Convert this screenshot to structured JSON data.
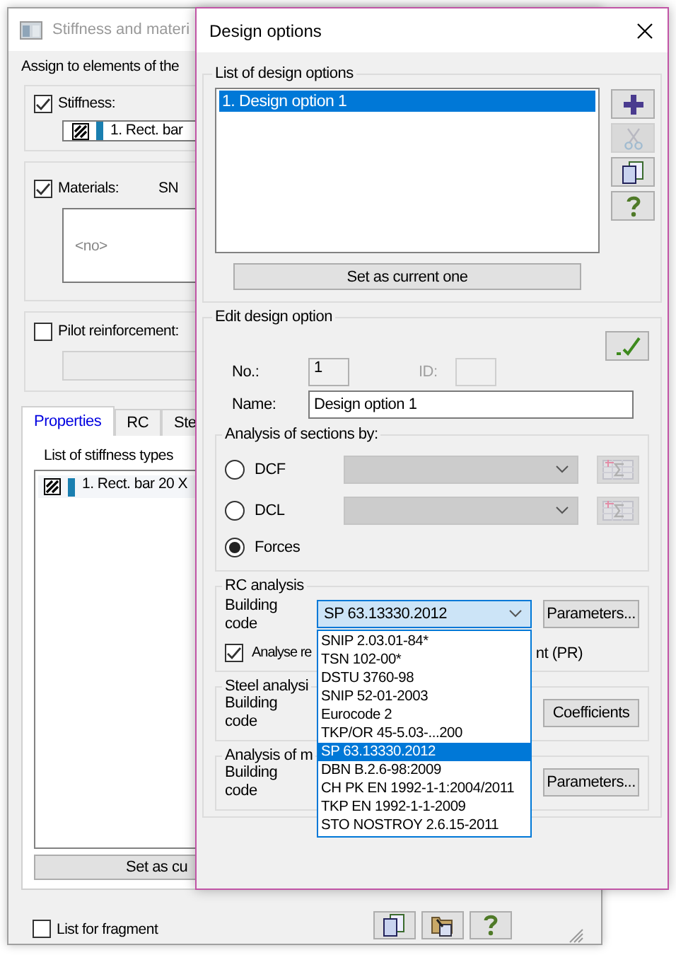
{
  "back_window": {
    "title": "Stiffness and materi",
    "assign_label": "Assign to elements of the",
    "stiffness": {
      "label": "Stiffness:",
      "checked": true,
      "value": "1. Rect. bar"
    },
    "materials": {
      "label": "Materials:",
      "checked": true,
      "code": "SN",
      "value": "<no>"
    },
    "pilot_reinforcement": {
      "label": "Pilot reinforcement:",
      "checked": false
    },
    "tabs": [
      {
        "label": "Properties",
        "selected": true
      },
      {
        "label": "RC",
        "selected": false
      },
      {
        "label": "Ste",
        "selected": false
      }
    ],
    "list_title": "List of stiffness types",
    "stiffness_types": [
      {
        "label": "1. Rect. bar 20 X"
      }
    ],
    "set_current_button": "Set as cu",
    "list_for_fragment": {
      "label": "List for fragment",
      "checked": false
    },
    "bottom_tools": [
      {
        "kind": "copy"
      },
      {
        "kind": "import"
      },
      {
        "kind": "help"
      }
    ]
  },
  "dialog": {
    "title": "Design options",
    "options_group": {
      "title": "List of design options",
      "items": [
        {
          "label": "1. Design option 1",
          "selected": true
        }
      ],
      "tools": [
        {
          "kind": "add",
          "disabled": false
        },
        {
          "kind": "cut",
          "disabled": true
        },
        {
          "kind": "copy",
          "disabled": false
        },
        {
          "kind": "help",
          "disabled": false
        }
      ],
      "set_current_button": "Set as current one"
    },
    "edit_group": {
      "title": "Edit design option",
      "number_label": "No.:",
      "number": "1",
      "id": {
        "label": "ID:",
        "disabled": true
      },
      "name_label": "Name:",
      "name": "Design option 1",
      "sections": {
        "title": "Analysis of sections by:",
        "options": [
          {
            "label": "DCF",
            "selected": false,
            "kind": "table"
          },
          {
            "label": "DCL",
            "selected": false,
            "kind": "table"
          },
          {
            "label": "Forces",
            "selected": true,
            "kind": "plain"
          }
        ]
      },
      "rc": {
        "title": "RC analysis",
        "code_label": "Building code",
        "code": "SP 63.13330.2012",
        "expanded": true,
        "button": "Parameters...",
        "codes": [
          {
            "label": "SNIP 2.03.01-84*",
            "selected": false
          },
          {
            "label": "TSN 102-00*",
            "selected": false
          },
          {
            "label": "DSTU 3760-98",
            "selected": false
          },
          {
            "label": "SNIP 52-01-2003",
            "selected": false
          },
          {
            "label": "Eurocode 2",
            "selected": false
          },
          {
            "label": "TKP/OR 45-5.03-...200",
            "selected": false
          },
          {
            "label": "SP 63.13330.2012",
            "selected": true
          },
          {
            "label": "DBN B.2.6-98:2009",
            "selected": false
          },
          {
            "label": "CH PK EN 1992-1-1:2004/2011",
            "selected": false
          },
          {
            "label": "TKP EN 1992-1-1-2009",
            "selected": false
          },
          {
            "label": "STO NOSTROY 2.6.15-2011",
            "selected": false
          }
        ],
        "check": {
          "label_start": "Analyse re",
          "label_end": "nt (PR)",
          "checked": true
        }
      },
      "steel": {
        "title": "Steel analysi",
        "code_label": "Building code",
        "button": "Coefficients"
      },
      "masonry": {
        "title": "Analysis of m",
        "code_label": "Building code",
        "button": "Parameters..."
      }
    }
  }
}
